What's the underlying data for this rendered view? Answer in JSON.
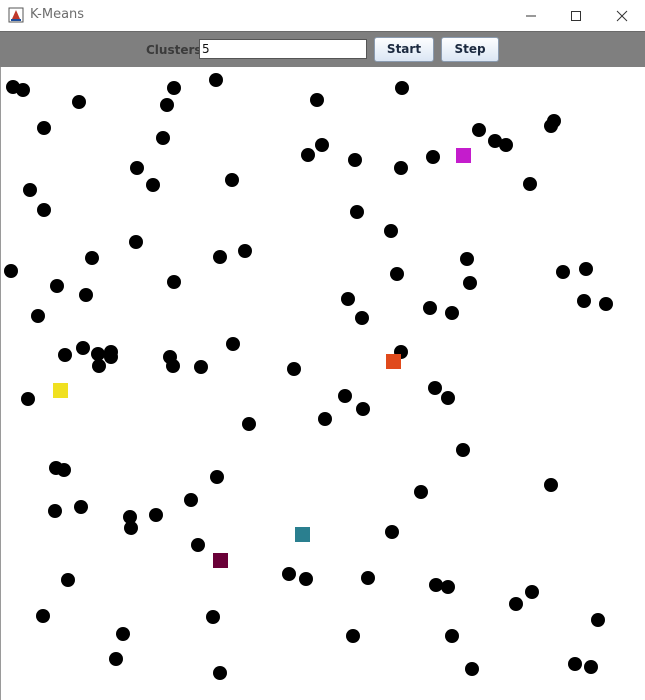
{
  "window": {
    "title": "K-Means",
    "icon": "java-app-icon"
  },
  "window_controls": [
    "minimize-icon",
    "maximize-icon",
    "close-icon"
  ],
  "toolbar": {
    "clusters_label": "Clusters",
    "clusters_value": "5",
    "start_label": "Start",
    "step_label": "Step"
  },
  "colors": {
    "toolbar_bg": "#7f7f7f",
    "point": "#000000",
    "centroids": [
      "#c41ccc",
      "#e04a1c",
      "#f0e020",
      "#2a7f8f",
      "#6a0038"
    ]
  }
}
